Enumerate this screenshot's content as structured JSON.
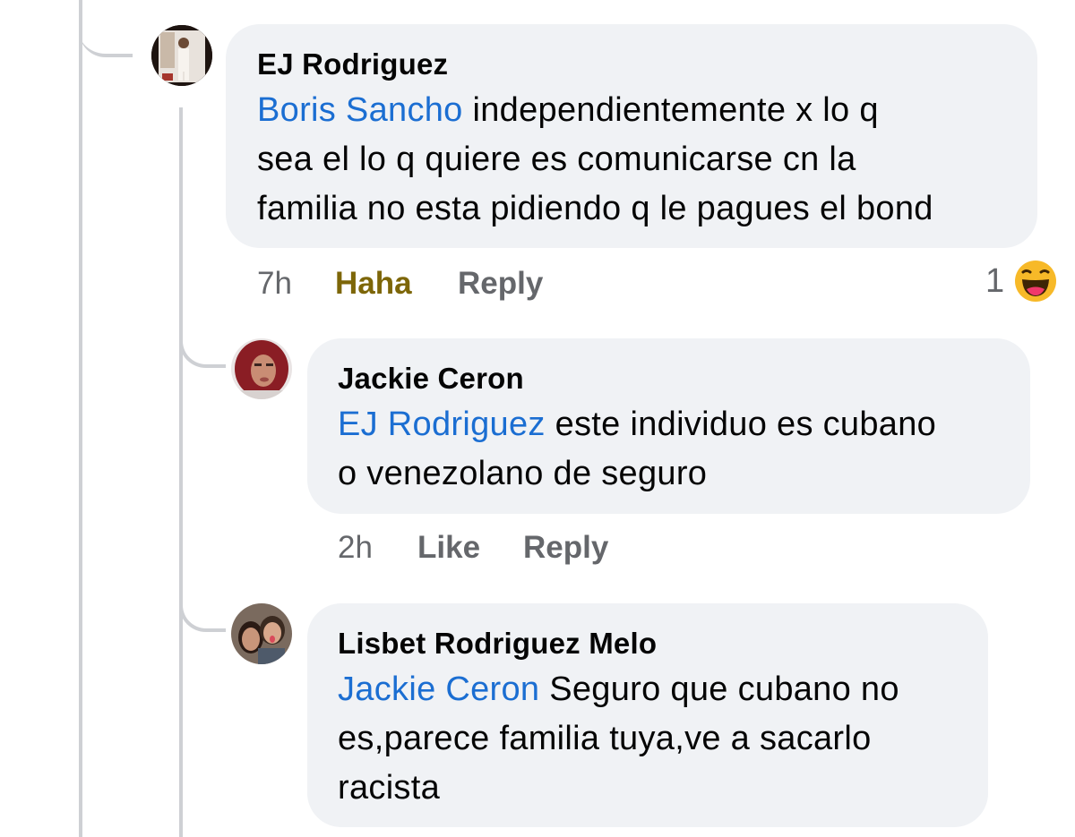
{
  "comments": [
    {
      "author": "EJ Rodriguez",
      "mention": "Boris Sancho",
      "text_line1": " independientemente x lo q",
      "text_line2": "sea el lo q quiere es comunicarse cn la",
      "text_line3": "familia no esta pidiendo q le pagues el bond",
      "time": "7h",
      "reaction_action": "Haha",
      "reply": "Reply",
      "reaction_count": "1",
      "reaction_icon": "haha-emoji-icon"
    },
    {
      "author": "Jackie Ceron",
      "mention": "EJ Rodriguez",
      "text_line1": " este individuo es cubano",
      "text_line2": "o venezolano de seguro",
      "time": "2h",
      "like": "Like",
      "reply": "Reply"
    },
    {
      "author": "Lisbet Rodriguez Melo",
      "mention": "Jackie Ceron",
      "text_line1": " Seguro que cubano no",
      "text_line2": "es,parece familia tuya,ve a sacarlo",
      "text_line3": "racista"
    }
  ],
  "colors": {
    "bubble": "#f0f2f5",
    "mention": "#1b6ed2",
    "meta": "#65676b",
    "haha": "#7d6608",
    "thread_line": "#ced0d4"
  }
}
